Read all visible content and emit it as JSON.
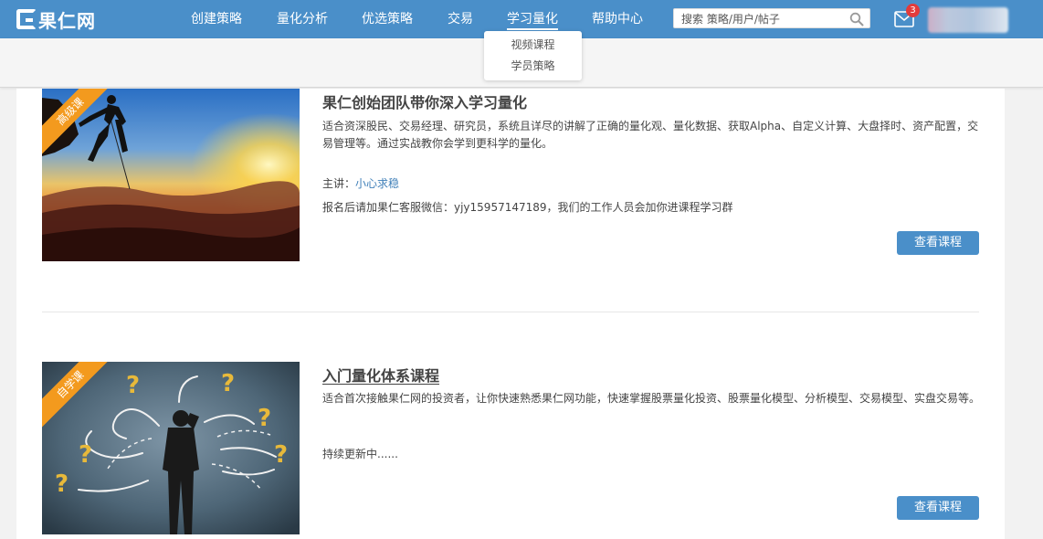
{
  "brand": {
    "logo_text": "果仁网",
    "accent_color": "#4a8fc9"
  },
  "nav": {
    "items": [
      {
        "label": "创建策略"
      },
      {
        "label": "量化分析"
      },
      {
        "label": "优选策略"
      },
      {
        "label": "交易"
      },
      {
        "label": "学习量化",
        "active": true
      },
      {
        "label": "帮助中心"
      }
    ],
    "search_placeholder": "搜索 策略/用户/帖子",
    "search_icon": "search-icon",
    "mail_icon": "mail-icon",
    "unread_count": "3"
  },
  "dropdown": {
    "items": [
      {
        "label": "视频课程"
      },
      {
        "label": "学员策略"
      }
    ]
  },
  "courses": [
    {
      "badge": "高级课",
      "title": "果仁创始团队带你深入学习量化",
      "description": "适合资深股民、交易经理、研究员，系统且详尽的讲解了正确的量化观、量化数据、获取Alpha、自定义计算、大盘择时、资产配置，交易管理等。通过实战教你会学到更科学的量化。",
      "teacher_label": "主讲：",
      "teacher_name": "小心求稳",
      "note": "报名后请加果仁客服微信：yjy15957147189，我们的工作人员会加你进课程学习群",
      "button": "查看课程"
    },
    {
      "badge": "自学课",
      "title": "入门量化体系课程",
      "description": "适合首次接触果仁网的投资者，让你快速熟悉果仁网功能，快速掌握股票量化投资、股票量化模型、分析模型、交易模型、实盘交易等。",
      "note": "持续更新中......",
      "button": "查看课程"
    }
  ],
  "colors": {
    "badge": "#f39a1e",
    "button": "#4a8fc9",
    "teacher_link": "#3f7fb8"
  }
}
